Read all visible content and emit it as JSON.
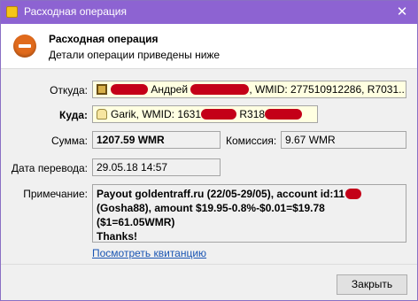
{
  "window": {
    "title": "Расходная операция",
    "close_glyph": "✕",
    "icon": "wallet-icon"
  },
  "header": {
    "title": "Расходная операция",
    "subtitle": "Детали операции приведены ниже",
    "icon": "stop-icon",
    "icon_color": "#e06a1c"
  },
  "fields": {
    "from_label": "Откуда:",
    "from_value_a": "Андрей",
    "from_value_b": ", WMID: 277510912286, R7031...",
    "to_label": "Куда:",
    "to_value_a": "Garik, WMID: 1631",
    "to_value_b": "R318",
    "sum_label": "Сумма:",
    "sum_value": "1207.59 WMR",
    "commission_label": "Комиссия:",
    "commission_value": "9.67 WMR",
    "date_label": "Дата перевода:",
    "date_value": "29.05.18 14:57",
    "note_label": "Примечание:",
    "note_line1": "Payout goldentraff.ru (22/05-29/05), account id:11",
    "note_line2": "(Gosha88), amount $19.95-0.8%-$0.01=$19.78 ($1=61.05WMR)",
    "note_line3": "Thanks!"
  },
  "link": {
    "text": "Посмотреть квитанцию"
  },
  "buttons": {
    "close": "Закрыть"
  },
  "colors": {
    "titlebar": "#8d63d2",
    "redaction": "#c40018",
    "link": "#1a55b3"
  }
}
